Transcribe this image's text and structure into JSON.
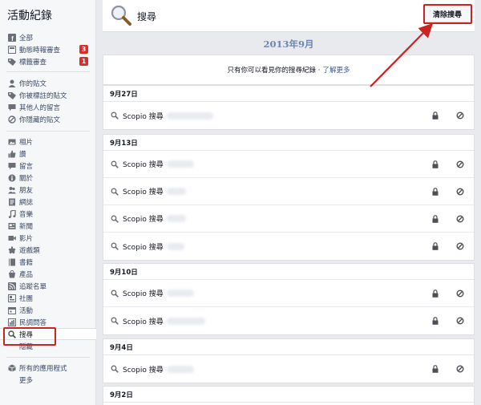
{
  "sidebar": {
    "title": "活動紀錄",
    "group1": [
      {
        "label": "全部",
        "icon": "facebook-icon"
      },
      {
        "label": "動態時報審查",
        "icon": "timeline-icon",
        "badge": "3"
      },
      {
        "label": "標籤審查",
        "icon": "tag-icon",
        "badge": "1"
      }
    ],
    "group2": [
      {
        "label": "你的貼文",
        "icon": "person-icon"
      },
      {
        "label": "你被標註的貼文",
        "icon": "tag-icon"
      },
      {
        "label": "其他人的留言",
        "icon": "comment-icon"
      },
      {
        "label": "你隱藏的貼文",
        "icon": "hidden-icon"
      }
    ],
    "group3": [
      {
        "label": "相片",
        "icon": "photo-icon"
      },
      {
        "label": "讚",
        "icon": "like-icon"
      },
      {
        "label": "留言",
        "icon": "comment-icon"
      },
      {
        "label": "關於",
        "icon": "info-icon"
      },
      {
        "label": "朋友",
        "icon": "friends-icon"
      },
      {
        "label": "網誌",
        "icon": "note-icon"
      },
      {
        "label": "音樂",
        "icon": "music-icon"
      },
      {
        "label": "新聞",
        "icon": "news-icon"
      },
      {
        "label": "影片",
        "icon": "video-icon"
      },
      {
        "label": "遊戲類",
        "icon": "game-icon"
      },
      {
        "label": "書籍",
        "icon": "book-icon"
      },
      {
        "label": "產品",
        "icon": "product-icon"
      },
      {
        "label": "追蹤名單",
        "icon": "rss-icon"
      },
      {
        "label": "社團",
        "icon": "group-icon"
      },
      {
        "label": "活動",
        "icon": "event-icon"
      },
      {
        "label": "民調問答",
        "icon": "poll-icon"
      },
      {
        "label": "搜尋",
        "icon": "search-icon"
      },
      {
        "label": "隱藏",
        "icon": ""
      }
    ],
    "group4": [
      {
        "label": "所有的應用程式",
        "icon": "apps-icon"
      },
      {
        "label": "更多",
        "icon": ""
      }
    ]
  },
  "header": {
    "title": "搜尋",
    "clear_button": "清除搜尋"
  },
  "month": "2013年9月",
  "notice": {
    "text": "只有你可以看見你的搜尋紀錄 ·",
    "link": "了解更多"
  },
  "days": [
    {
      "date": "9月27日",
      "rows": [
        "Scopio 搜尋"
      ]
    },
    {
      "date": "9月13日",
      "rows": [
        "Scopio 搜尋",
        "Scopio 搜尋",
        "Scopio 搜尋",
        "Scopio 搜尋"
      ]
    },
    {
      "date": "9月10日",
      "rows": [
        "Scopio 搜尋",
        "Scopio 搜尋"
      ]
    },
    {
      "date": "9月4日",
      "rows": [
        "Scopio 搜尋"
      ]
    },
    {
      "date": "9月2日",
      "rows": []
    }
  ],
  "colors": {
    "accent": "#3b5998",
    "badge": "#e02a2a",
    "highlight": "#cc2222",
    "month_text": "#6d84b4"
  }
}
